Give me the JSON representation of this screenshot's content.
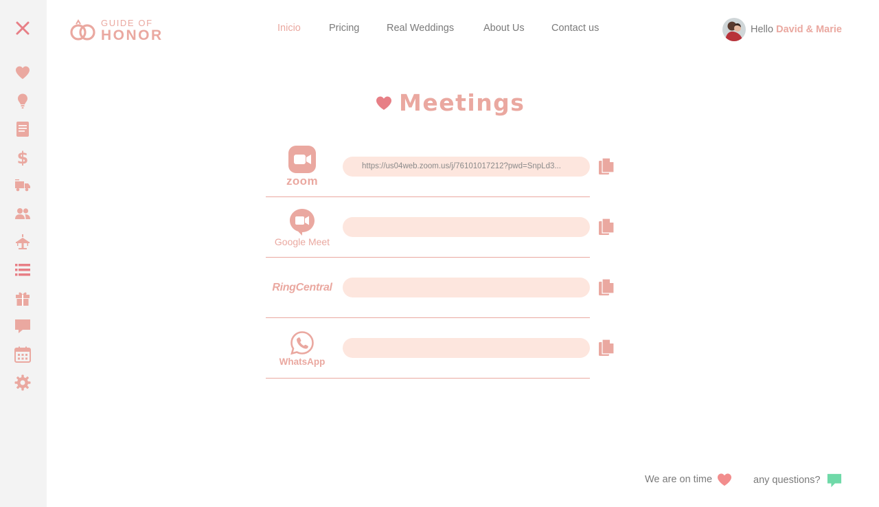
{
  "app": {
    "logo_top": "GUIDE OF",
    "logo_bottom": "HONOR"
  },
  "nav": {
    "items": [
      {
        "label": "Inicio",
        "active": true
      },
      {
        "label": "Pricing"
      },
      {
        "label": "Real Weddings"
      },
      {
        "label": "About Us"
      },
      {
        "label": "Contact us"
      }
    ]
  },
  "user": {
    "greeting": "Hello",
    "name": "David & Marie"
  },
  "sidebar": {
    "icons": [
      "close-icon",
      "heart-icon",
      "lightbulb-icon",
      "notes-icon",
      "dollar-icon",
      "truck-icon",
      "users-icon",
      "cake-icon",
      "list-icon",
      "gift-icon",
      "chat-icon",
      "calendar-icon",
      "gear-icon"
    ],
    "active": "list-icon"
  },
  "page": {
    "title": "Meetings"
  },
  "meetings": [
    {
      "service": "zoom",
      "label": "zoom",
      "link": "https://us04web.zoom.us/j/76101017212?pwd=SnpLd3..."
    },
    {
      "service": "google-meet",
      "label": "Google Meet",
      "link": ""
    },
    {
      "service": "ringcentral",
      "label": "RingCentral",
      "link": ""
    },
    {
      "service": "whatsapp",
      "label": "WhatsApp",
      "link": ""
    }
  ],
  "footer": {
    "on_time": "We are on time",
    "questions": "any questions?"
  },
  "colors": {
    "accent": "#eaa8a0",
    "accent_strong": "#e77f86",
    "field_bg": "#fde6de",
    "chat_green": "#6fd9a8",
    "sidebar_bg": "#f3f3f3",
    "text": "#7a7a7a"
  }
}
